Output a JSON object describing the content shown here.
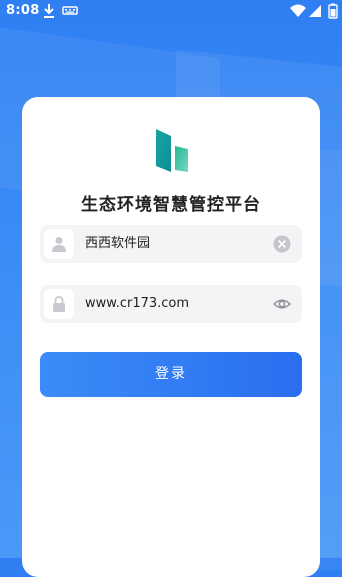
{
  "status_bar": {
    "time": "8:08"
  },
  "app": {
    "title": "生态环境智慧管控平台"
  },
  "form": {
    "username_value": "西西软件园",
    "password_value": "www.cr173.com",
    "login_label": "登录"
  },
  "colors": {
    "primary": "#2f7ff3",
    "button": "#3b8cf8",
    "field_bg": "#f4f4f6"
  },
  "icons": {
    "username": "user-icon",
    "clear": "clear-icon",
    "password": "lock-icon",
    "show_password": "eye-icon"
  }
}
